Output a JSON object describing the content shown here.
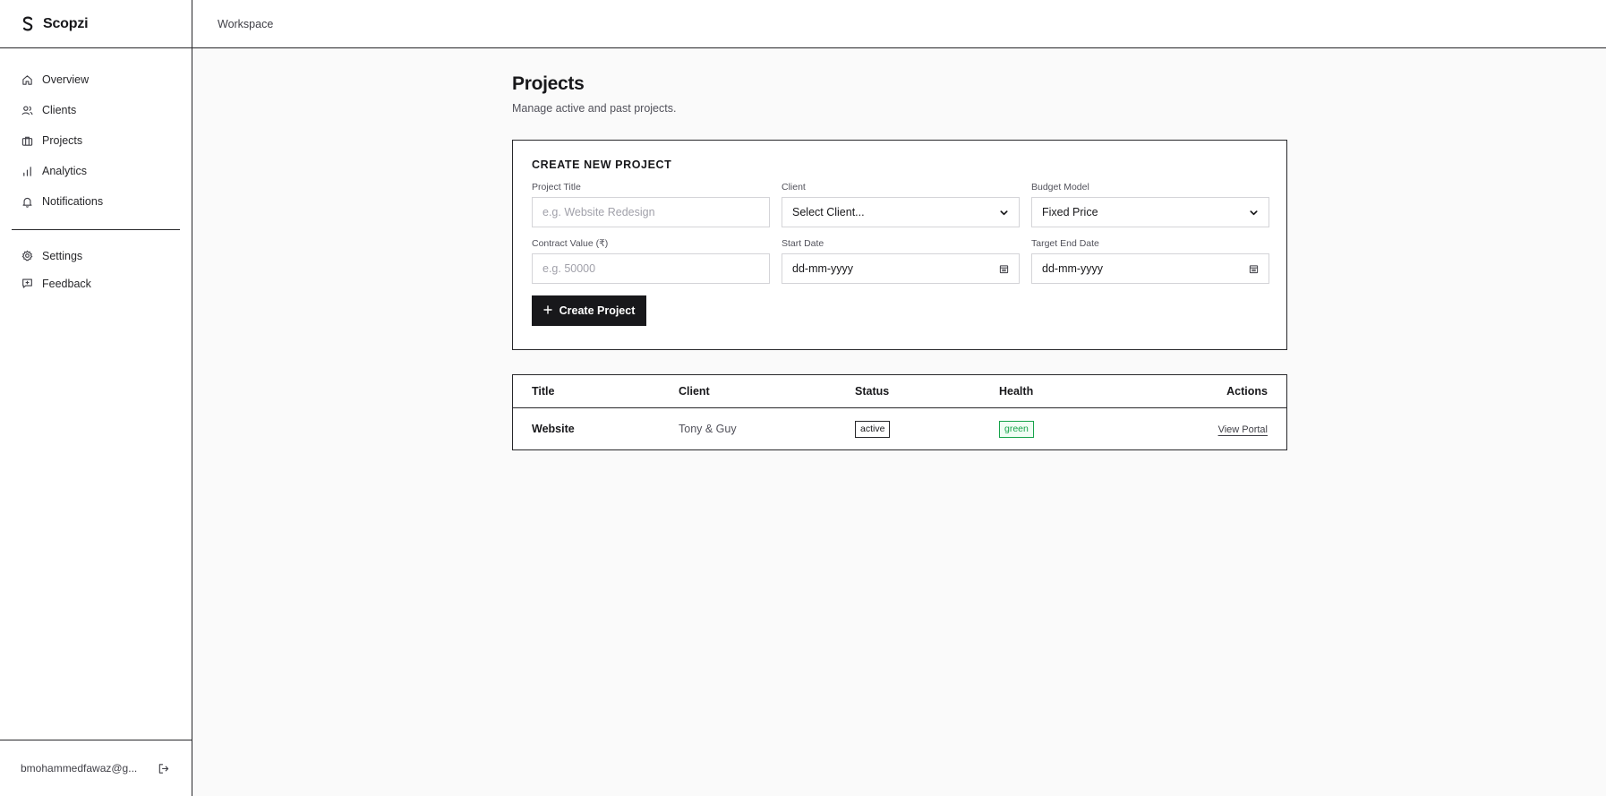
{
  "brand": {
    "name": "Scopzi",
    "logo_icon": "s-logo-icon"
  },
  "sidebar": {
    "items": [
      {
        "label": "Overview",
        "icon": "home-icon"
      },
      {
        "label": "Clients",
        "icon": "users-icon"
      },
      {
        "label": "Projects",
        "icon": "briefcase-icon"
      },
      {
        "label": "Analytics",
        "icon": "bar-chart-icon"
      },
      {
        "label": "Notifications",
        "icon": "bell-icon"
      }
    ],
    "secondary": [
      {
        "label": "Settings",
        "icon": "gear-icon"
      },
      {
        "label": "Feedback",
        "icon": "feedback-icon"
      }
    ],
    "user_email": "bmohammedfawaz@g...",
    "logout_icon": "logout-icon"
  },
  "topbar": {
    "label": "Workspace"
  },
  "page": {
    "title": "Projects",
    "subtitle": "Manage active and past projects."
  },
  "form": {
    "title": "CREATE NEW PROJECT",
    "fields": {
      "project_title": {
        "label": "Project Title",
        "placeholder": "e.g. Website Redesign"
      },
      "client": {
        "label": "Client",
        "value": "Select Client..."
      },
      "budget_model": {
        "label": "Budget Model",
        "value": "Fixed Price"
      },
      "contract_value": {
        "label": "Contract Value (₹)",
        "placeholder": "e.g. 50000"
      },
      "start_date": {
        "label": "Start Date",
        "value": "dd-mm-yyyy"
      },
      "target_end_date": {
        "label": "Target End Date",
        "value": "dd-mm-yyyy"
      }
    },
    "submit_label": "Create Project"
  },
  "table": {
    "headers": {
      "title": "Title",
      "client": "Client",
      "status": "Status",
      "health": "Health",
      "actions": "Actions"
    },
    "rows": [
      {
        "title": "Website",
        "client": "Tony & Guy",
        "status": "active",
        "health": "green",
        "action": "View Portal"
      }
    ]
  },
  "colors": {
    "primary": "#18181b",
    "health_green": "#16a34a",
    "background": "#fafafa"
  }
}
